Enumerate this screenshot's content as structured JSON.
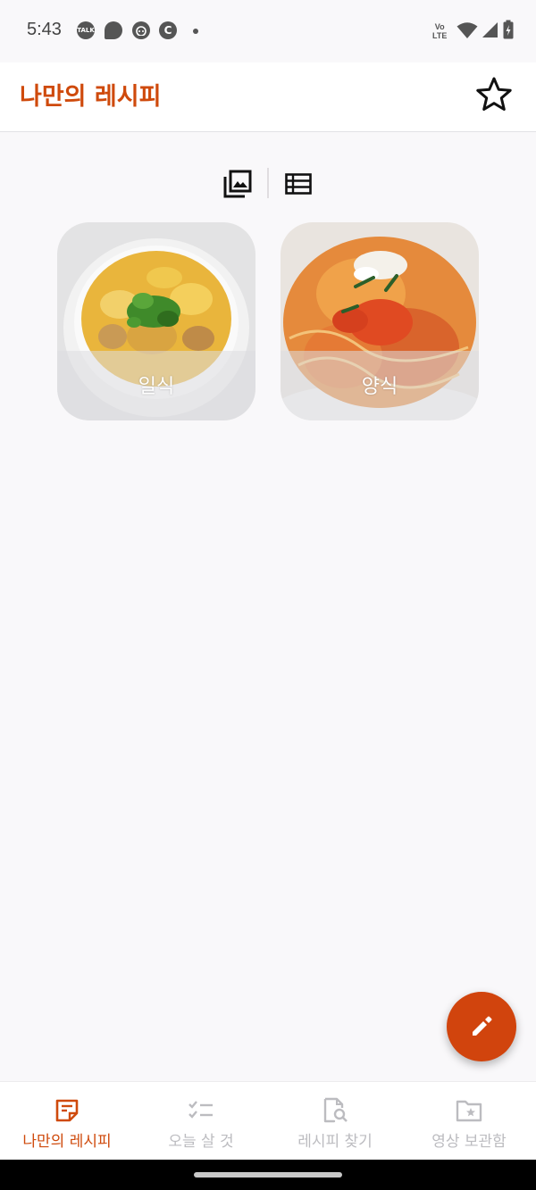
{
  "status_bar": {
    "time": "5:43",
    "notification_icons": [
      {
        "name": "kakaotalk-icon",
        "text": "TALK"
      },
      {
        "name": "chat-bubble-icon",
        "text": ""
      },
      {
        "name": "cat-face-icon",
        "text": ""
      },
      {
        "name": "c-circle-icon",
        "text": "C"
      }
    ],
    "volte_line1": "Vo",
    "volte_line2": "LTE"
  },
  "app_bar": {
    "title": "나만의 레시피",
    "title_color": "#cf4a0c",
    "favorite_icon": "star-outline-icon"
  },
  "view_toggle": {
    "options": [
      {
        "name": "gallery-view-icon",
        "selected": true
      },
      {
        "name": "list-view-icon",
        "selected": false
      }
    ]
  },
  "categories": [
    {
      "label": "일식",
      "image": "oyakodon-bowl"
    },
    {
      "label": "양식",
      "image": "tomato-spaghetti"
    }
  ],
  "fab": {
    "icon": "pencil-icon",
    "color": "#d1440d"
  },
  "bottom_nav": {
    "active_color": "#cf4a0c",
    "inactive_color": "#bcbcc0",
    "items": [
      {
        "label": "나만의 레시피",
        "icon": "recipe-note-icon",
        "active": true
      },
      {
        "label": "오늘 살 것",
        "icon": "checklist-icon",
        "active": false
      },
      {
        "label": "레시피 찾기",
        "icon": "document-search-icon",
        "active": false
      },
      {
        "label": "영상 보관함",
        "icon": "folder-star-icon",
        "active": false
      }
    ]
  }
}
